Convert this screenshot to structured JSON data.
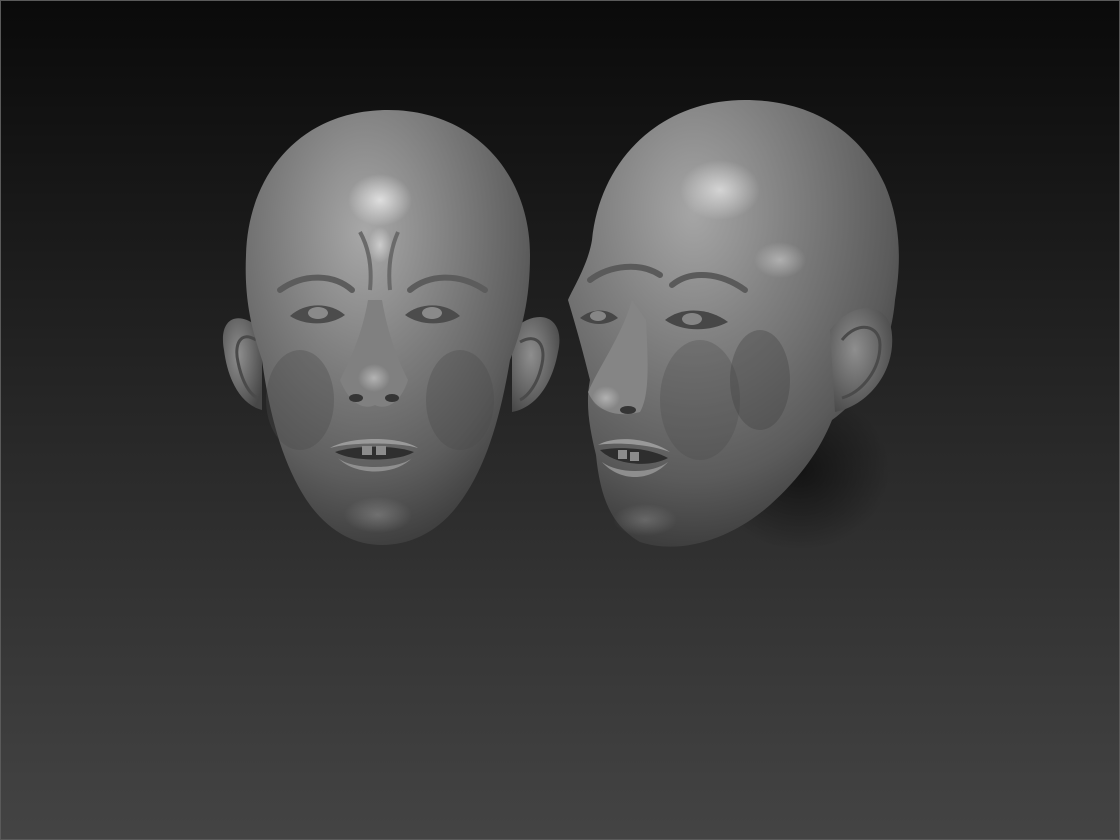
{
  "viewport": {
    "background_top_color": "#0a0a0a",
    "background_bottom_color": "#444444",
    "frame_color": "#5a5a5a"
  },
  "models": [
    {
      "name": "head-sculpt-front",
      "view": "front",
      "material_color": "#7d7d7d"
    },
    {
      "name": "head-sculpt-three-quarter",
      "view": "three-quarter",
      "material_color": "#7a7a7a"
    }
  ]
}
